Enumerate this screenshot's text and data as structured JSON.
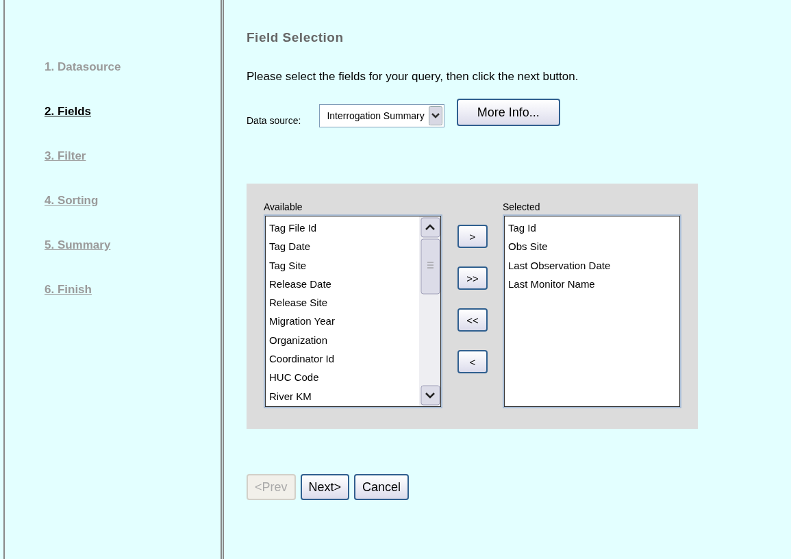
{
  "steps": [
    {
      "label": "1. Datasource",
      "selected": false,
      "underlined": false
    },
    {
      "label": "2. Fields",
      "selected": true,
      "underlined": true
    },
    {
      "label": "3. Filter",
      "selected": false,
      "underlined": true
    },
    {
      "label": "4. Sorting",
      "selected": false,
      "underlined": true
    },
    {
      "label": "5. Summary",
      "selected": false,
      "underlined": true
    },
    {
      "label": "6. Finish",
      "selected": false,
      "underlined": true
    }
  ],
  "title": "Field Selection",
  "instruction": "Please select the fields for your query, then click the next button.",
  "data_source": {
    "label": "Data source:",
    "value": "Interrogation Summary"
  },
  "more_info_button": "More Info...",
  "available": {
    "label": "Available",
    "items": [
      "Tag File Id",
      "Tag Date",
      "Tag Site",
      "Release Date",
      "Release Site",
      "Migration Year",
      "Organization",
      "Coordinator Id",
      "HUC Code",
      "River KM"
    ]
  },
  "move_buttons": [
    ">",
    ">>",
    "<<",
    "<"
  ],
  "selected": {
    "label": "Selected",
    "items": [
      "Tag Id",
      "Obs Site",
      "Last Observation Date",
      "Last Monitor Name"
    ]
  },
  "nav_buttons": [
    {
      "label": "<Prev",
      "disabled": true
    },
    {
      "label": "Next>",
      "disabled": false
    },
    {
      "label": "Cancel",
      "disabled": false
    }
  ]
}
